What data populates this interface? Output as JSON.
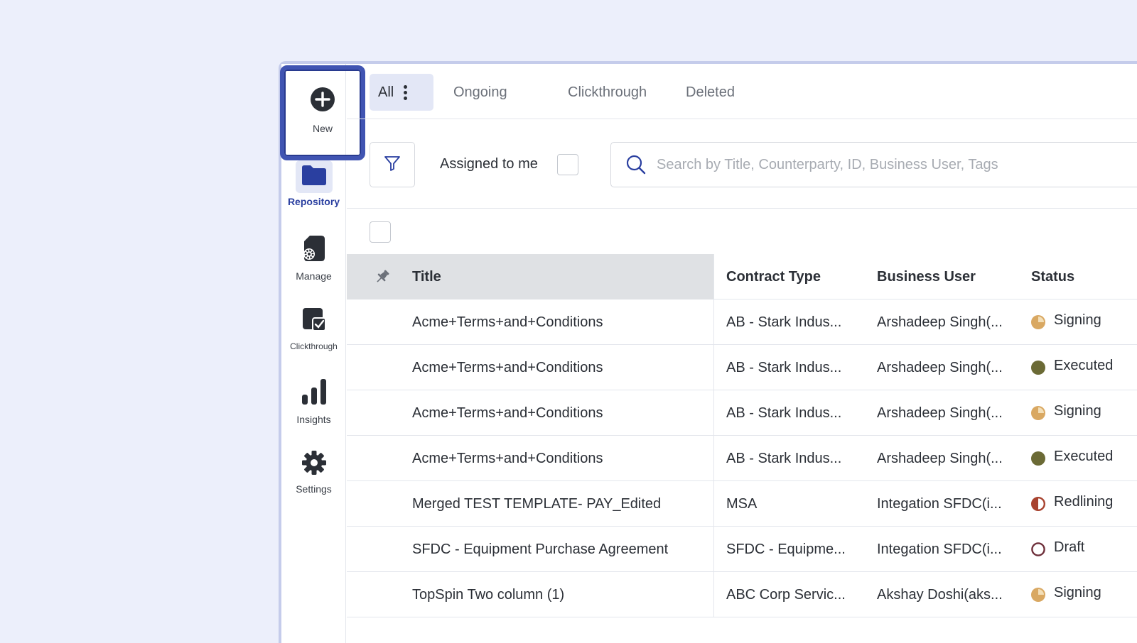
{
  "sidebar": {
    "new_label": "New",
    "items": [
      {
        "label": "Repository"
      },
      {
        "label": "Manage"
      },
      {
        "label": "Clickthrough"
      },
      {
        "label": "Insights"
      },
      {
        "label": "Settings"
      }
    ]
  },
  "tabs": [
    {
      "label": "All"
    },
    {
      "label": "Ongoing"
    },
    {
      "label": "Clickthrough"
    },
    {
      "label": "Deleted"
    }
  ],
  "toolbar": {
    "assigned_label": "Assigned to me",
    "search_placeholder": "Search by Title, Counterparty, ID, Business User, Tags"
  },
  "table": {
    "columns": [
      "Title",
      "Contract Type",
      "Business User",
      "Status"
    ],
    "rows": [
      {
        "title": "Acme+Terms+and+Conditions",
        "type": "AB - Stark Indus...",
        "user": "Arshadeep Singh(...",
        "status": "Signing"
      },
      {
        "title": "Acme+Terms+and+Conditions",
        "type": "AB - Stark Indus...",
        "user": "Arshadeep Singh(...",
        "status": "Executed"
      },
      {
        "title": "Acme+Terms+and+Conditions",
        "type": "AB - Stark Indus...",
        "user": "Arshadeep Singh(...",
        "status": "Signing"
      },
      {
        "title": "Acme+Terms+and+Conditions",
        "type": "AB - Stark Indus...",
        "user": "Arshadeep Singh(...",
        "status": "Executed"
      },
      {
        "title": "Merged TEST TEMPLATE- PAY_Edited",
        "type": "MSA",
        "user": "Integation SFDC(i...",
        "status": "Redlining"
      },
      {
        "title": "SFDC - Equipment Purchase Agreement",
        "type": "SFDC - Equipme...",
        "user": "Integation SFDC(i...",
        "status": "Draft"
      },
      {
        "title": "TopSpin Two column (1)",
        "type": "ABC Corp Servic...",
        "user": "Akshay Doshi(aks...",
        "status": "Signing"
      }
    ]
  },
  "colors": {
    "accent": "#2a3fa0",
    "focus_ring": "#4054b2",
    "status_signing": "#d9a862",
    "status_executed": "#6b6a35",
    "status_redlining": "#a8432f",
    "status_draft": "#6e2f3a"
  }
}
